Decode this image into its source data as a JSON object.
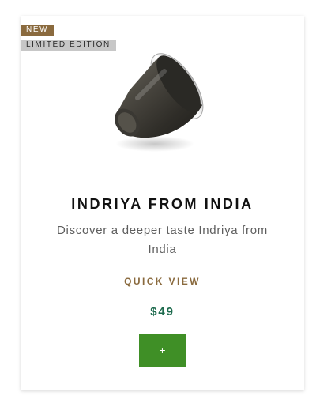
{
  "product": {
    "badges": {
      "new": "NEW",
      "limited": "LIMITED EDITION"
    },
    "image": {
      "icon": "coffee-capsule-image"
    },
    "name": "INDRIYA FROM INDIA",
    "description": "Discover a deeper taste Indriya from India",
    "quick_view_label": "QUICK VIEW",
    "price": "$49",
    "add_button_label": "+"
  },
  "colors": {
    "badge_new_bg": "#8a6a3e",
    "badge_limited_bg": "#c7c7c7",
    "accent_gold": "#8a6a3e",
    "price_green": "#1e6b4e",
    "button_green": "#3f8f26"
  }
}
